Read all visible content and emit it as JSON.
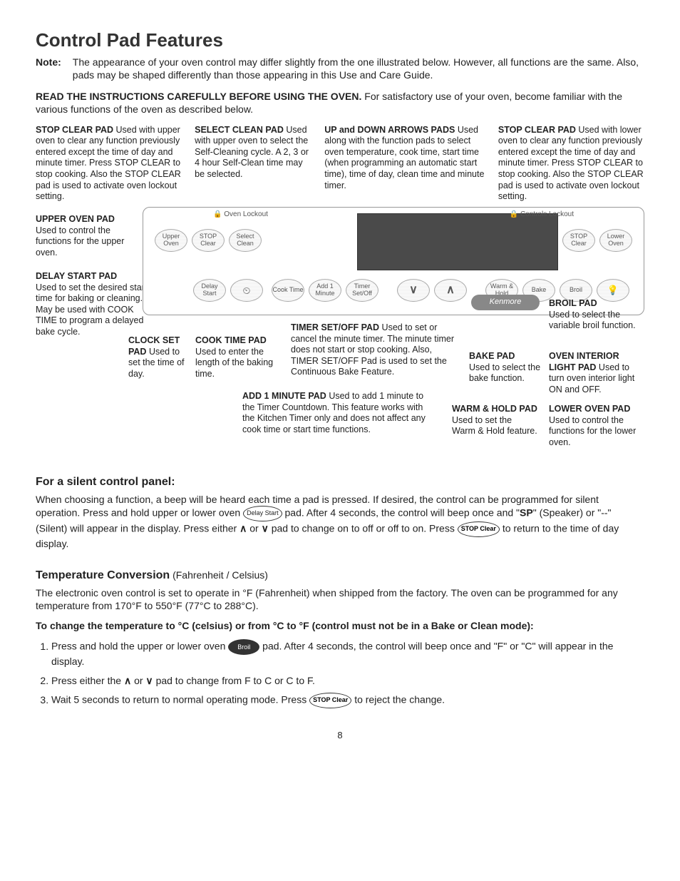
{
  "page": {
    "title": "Control Pad Features",
    "noteLabel": "Note:",
    "noteText": "The appearance of your oven control may differ slightly from the one illustrated below. However, all functions are the same. Also, pads may be shaped differently than those appearing in this Use and Care Guide.",
    "readBold": "READ THE INSTRUCTIONS CAREFULLY BEFORE USING THE OVEN.",
    "readText": " For satisfactory use of your oven, become familiar with the various functions of the oven as described below.",
    "pageNumber": "8"
  },
  "callouts": {
    "stopClearUpper": {
      "title": "STOP CLEAR PAD",
      "text": " Used with upper oven to clear any function previously entered except the time of day and minute timer. Press STOP CLEAR to stop cooking. Also the STOP CLEAR pad is used to activate oven lockout setting."
    },
    "selectClean": {
      "title": "SELECT CLEAN PAD",
      "text": " Used with upper oven to select the Self-Cleaning cycle. A 2, 3 or 4 hour Self-Clean time may be selected."
    },
    "arrows": {
      "title": "UP and DOWN ARROWS PADS",
      "text": " Used along with the function pads to select oven temperature, cook time, start time (when programming an automatic start time), time of day, clean time and minute timer."
    },
    "stopClearLower": {
      "title": "STOP CLEAR PAD",
      "text": " Used with lower oven to clear any function previously entered except the time of day and minute timer. Press STOP CLEAR to stop cooking. Also the STOP CLEAR pad is used to activate oven lockout setting."
    },
    "upperOven": {
      "title": "UPPER OVEN PAD",
      "text": "Used to control the functions for the upper oven."
    },
    "delayStart": {
      "title": "DELAY START PAD",
      "text": "Used to set the desired start time for baking or cleaning. May be used with COOK TIME to program a delayed bake cycle."
    },
    "clockSet": {
      "title": "CLOCK SET PAD",
      "text": " Used to set the time of day."
    },
    "cookTime": {
      "title": "COOK TIME PAD",
      "text": " Used to enter the length of the baking time."
    },
    "timerSetOff": {
      "title": "TIMER SET/OFF PAD",
      "text": " Used to set or cancel the minute timer. The minute timer does not start or stop cooking. Also, TIMER SET/OFF Pad is used to set the Continuous Bake Feature."
    },
    "add1Minute": {
      "title": "ADD 1 MINUTE PAD",
      "text": " Used to add 1 minute to the Timer Countdown. This feature works with the Kitchen Timer only and does not affect any cook time or start time functions."
    },
    "broil": {
      "title": "BROIL PAD",
      "text": "Used to select the variable broil function."
    },
    "bake": {
      "title": "BAKE PAD",
      "text": "Used to select the bake function."
    },
    "ovenLight": {
      "title": "OVEN INTERIOR LIGHT PAD",
      "text": " Used to turn oven interior light ON and OFF."
    },
    "warmHold": {
      "title": "WARM & HOLD PAD",
      "text": "Used to set the Warm & Hold feature."
    },
    "lowerOven": {
      "title": "LOWER OVEN PAD",
      "text": "Used to control the functions for the lower oven."
    }
  },
  "panel": {
    "lockoutUpper": "Oven Lockout",
    "lockoutLower": "Controls Lockout",
    "pads": {
      "upperOven": "Upper Oven",
      "stopClearU": "STOP Clear",
      "selectClean": "Select Clean",
      "stopClearL": "STOP Clear",
      "lowerOven": "Lower Oven",
      "delayStart": "Delay Start",
      "clock": "⏲",
      "cookTime": "Cook Time",
      "add1": "Add 1 Minute",
      "timer": "Timer Set/Off",
      "down": "∨",
      "up": "∧",
      "warmHold": "Warm & Hold",
      "bake": "Bake",
      "broil": "Broil",
      "light": "💡"
    },
    "logo": "Kenmore"
  },
  "silent": {
    "heading": "For a silent control panel:",
    "p1a": "When choosing a function, a beep will be heard each time a pad is pressed. If desired, the control can be programmed for silent operation. Press and hold upper or lower oven ",
    "delayPad": "Delay Start",
    "p1b": " pad. After 4 seconds, the control will beep once and \"",
    "sp": "SP",
    "p1c": "\" (Speaker) or \"--\" (Silent) will appear in the display. Press either ",
    "up": "∧",
    "or1": " or ",
    "down": "∨",
    "p1d": " pad to change on to off or off to on. Press ",
    "stopPad": "STOP Clear",
    "p1e": " to return to the time of day display."
  },
  "temp": {
    "heading": "Temperature Conversion",
    "sub": " (Fahrenheit / Celsius)",
    "p1": "The electronic oven control is set to operate in °F (Fahrenheit) when shipped from the factory. The oven can be programmed for any temperature from 170°F to 550°F (77°C to 288°C).",
    "p2": "To change the temperature to °C (celsius) or from °C to °F (control must not be in a Bake or Clean mode):",
    "step1a": "Press and hold the upper or lower oven ",
    "broilPad": "Broil",
    "step1b": " pad. After 4 seconds, the control will beep once and \"F\" or \"C\" will appear in the display.",
    "step2a": "Press either the ",
    "up": "∧",
    "or": " or ",
    "down": "∨",
    "step2b": " pad to change from F to C or C to F.",
    "step3a": "Wait 5 seconds to return to normal operating mode. Press ",
    "stopPad": "STOP Clear",
    "step3b": " to reject the change."
  }
}
